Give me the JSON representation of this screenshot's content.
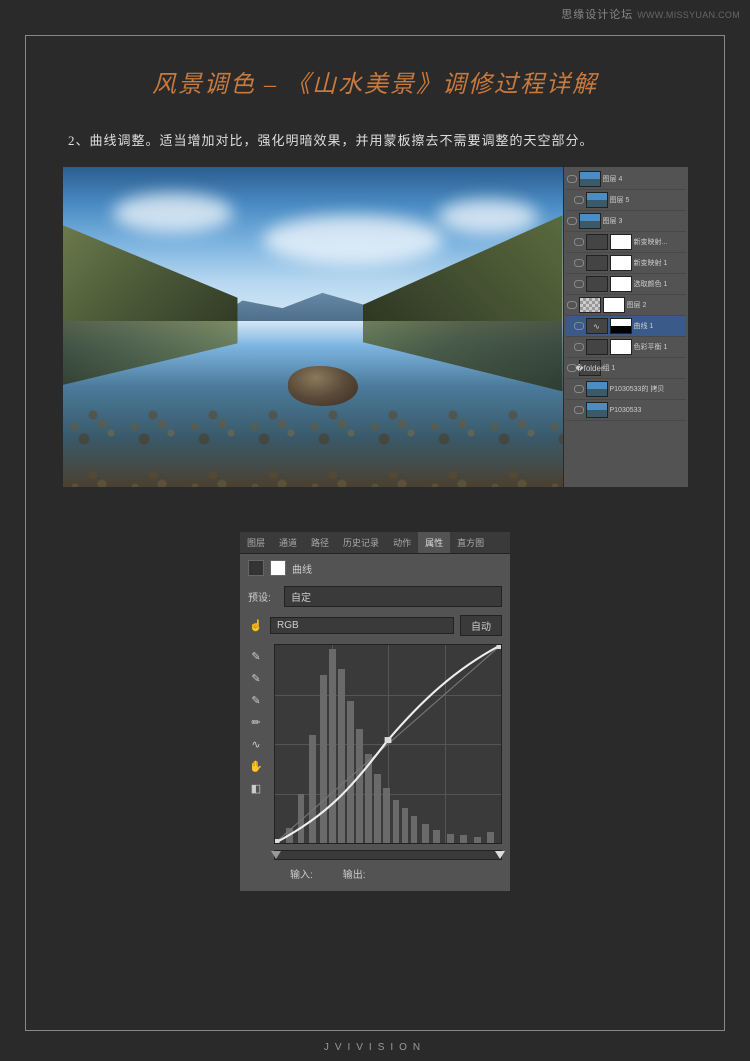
{
  "watermark": {
    "cn": "思缘设计论坛",
    "en": "WWW.MISSYUAN.COM"
  },
  "title": "风景调色 – 《山水美景》调修过程详解",
  "body": "2、曲线调整。适当增加对比，强化明暗效果，并用蒙板擦去不需要调整的天空部分。",
  "canvas_label": "Jvivision",
  "layers": {
    "items": [
      {
        "name": "图层 4"
      },
      {
        "name": "图层 5"
      },
      {
        "name": "图层 3"
      },
      {
        "name": "新变映射..."
      },
      {
        "name": "新变映射 1"
      },
      {
        "name": "选取颜色 1"
      },
      {
        "name": "图层 2"
      },
      {
        "name": "曲线 1"
      },
      {
        "name": "色彩平衡 1"
      },
      {
        "name": "组 1"
      },
      {
        "name": "P1030533的 拷贝"
      },
      {
        "name": "P1030533"
      }
    ]
  },
  "props": {
    "tabs": [
      "图层",
      "通道",
      "路径",
      "历史记录",
      "动作",
      "属性",
      "直方图"
    ],
    "title": "曲线",
    "preset_label": "预设:",
    "preset_value": "自定",
    "channel": "RGB",
    "auto": "自动",
    "input_label": "输入:",
    "output_label": "输出:"
  },
  "footer": "JVIVISION"
}
